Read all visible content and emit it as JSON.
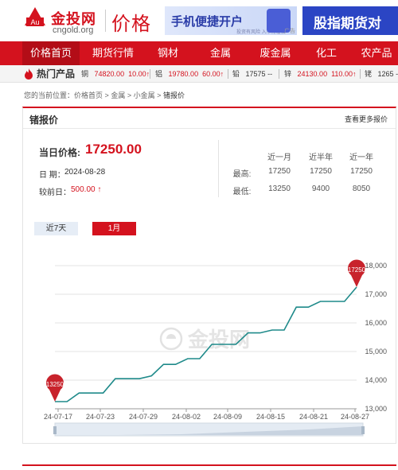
{
  "header": {
    "logo_cn": "金投网",
    "logo_en": "cngold.org",
    "logo_mark": "Au",
    "category": "价格",
    "ad1_text": "手机便捷开户",
    "ad1_sub": "投资有风险 入市需谨慎",
    "ad1_tag": "广告",
    "ad2_text": "股指期货对"
  },
  "nav": [
    "价格首页",
    "期货行情",
    "钢材",
    "金属",
    "废金属",
    "化工",
    "农产品"
  ],
  "hot": {
    "title": "热门产品",
    "items": [
      {
        "name": "铜",
        "value": "74820.00",
        "change": "10.00↑"
      },
      {
        "name": "铝",
        "value": "19780.00",
        "change": "60.00↑"
      },
      {
        "name": "铅",
        "value": "17575",
        "change": "--"
      },
      {
        "name": "锌",
        "value": "24130.00",
        "change": "110.00↑"
      },
      {
        "name": "铑",
        "value": "1265",
        "change": "--"
      }
    ]
  },
  "breadcrumb": {
    "prefix": "您的当前位置：",
    "items": [
      "价格首页",
      "金属",
      "小金属",
      "锗报价"
    ],
    "sep": ">"
  },
  "panel": {
    "title": "锗报价",
    "more": "查看更多报价",
    "price_label": "当日价格:",
    "price_value": "17250.00",
    "date_label": "日 期：",
    "date_value": "2024-08-28",
    "change_label": "较前日：",
    "change_value": "500.00 ↑",
    "stats": {
      "headers": [
        "近一月",
        "近半年",
        "近一年"
      ],
      "high_label": "最高:",
      "low_label": "最低:",
      "high": [
        "17250",
        "17250",
        "17250"
      ],
      "low": [
        "13250",
        "9400",
        "8050"
      ]
    },
    "tabs": [
      "近7天",
      "1月"
    ],
    "active_tab": "1月"
  },
  "chart_data": {
    "type": "line",
    "x_ticks": [
      "24-07-17",
      "24-07-23",
      "24-07-29",
      "24-08-02",
      "24-08-09",
      "24-08-15",
      "24-08-21",
      "24-08-27"
    ],
    "y_ticks": [
      "13,000",
      "14,000",
      "15,000",
      "16,000",
      "17,000",
      "18,000"
    ],
    "ylim": [
      13000,
      18000
    ],
    "watermark": "金投网",
    "series": [
      {
        "values": [
          13250,
          13250,
          13550,
          13550,
          13550,
          14050,
          14050,
          14050,
          14150,
          14550,
          14550,
          14750,
          14750,
          15250,
          15250,
          15250,
          15650,
          15650,
          15750,
          15750,
          16550,
          16550,
          16750,
          16750,
          16750,
          17250
        ]
      }
    ],
    "start_marker": "13250",
    "end_marker": "17250",
    "line_color": "#1f8a8a",
    "marker_color": "#c8232c",
    "grid": true
  }
}
